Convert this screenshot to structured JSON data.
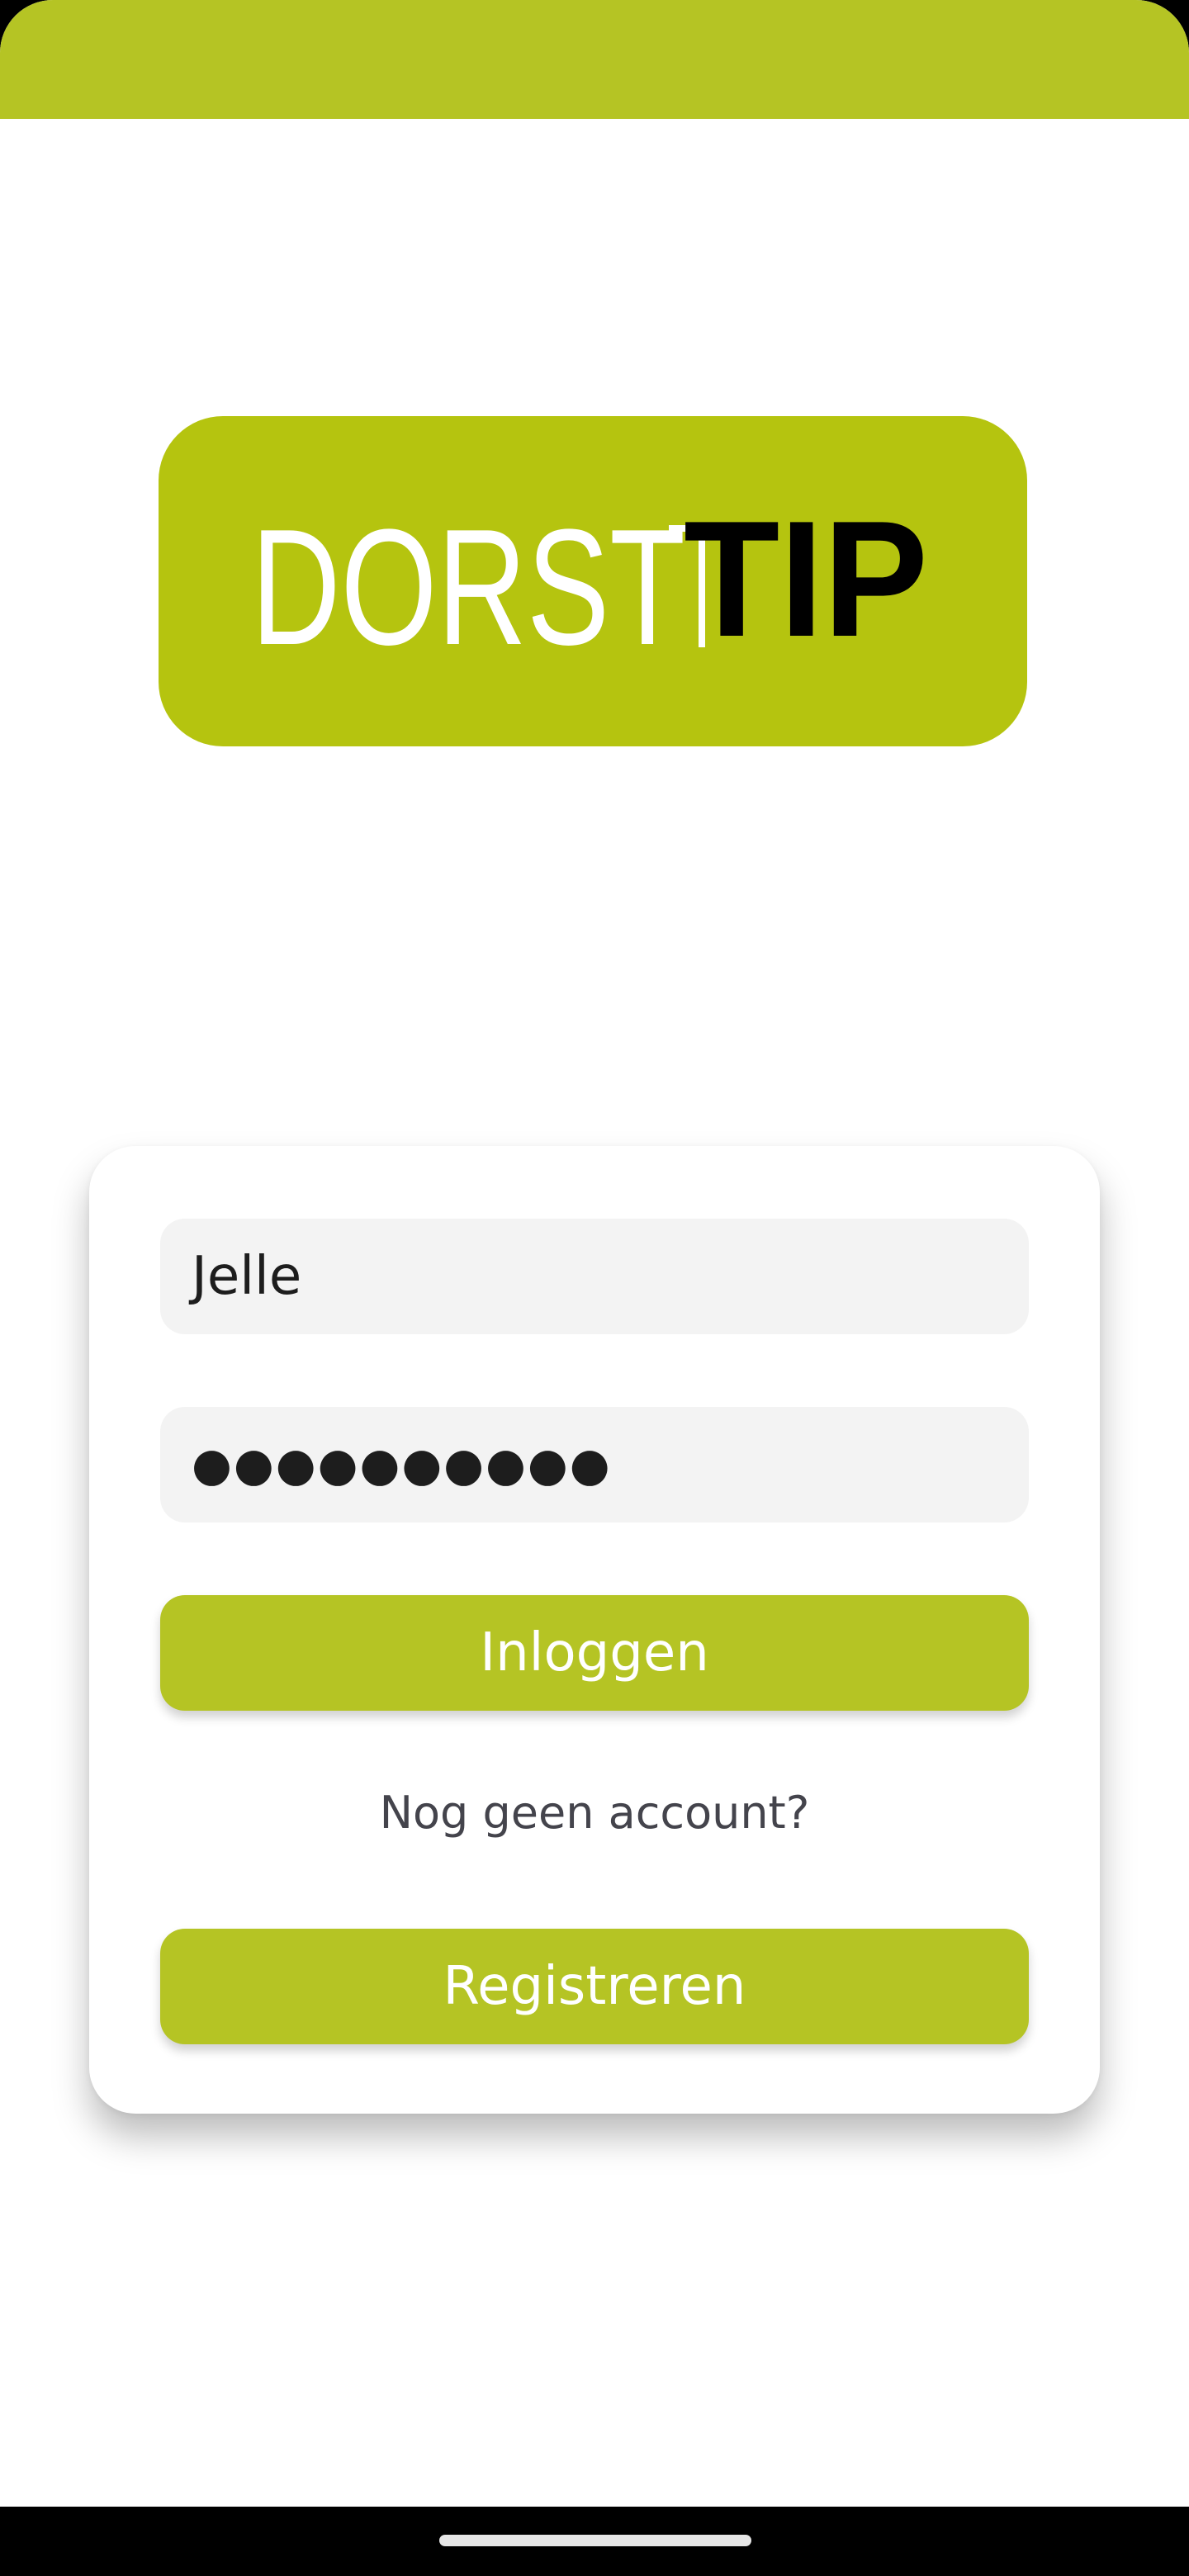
{
  "theme": {
    "accent": "#b5c424",
    "logo_background": "#b5c40f",
    "field_background": "#f3f3f3",
    "text_dark": "#1d1d1d",
    "text_muted": "#44444c"
  },
  "logo": {
    "part1": "DORST",
    "part2": "TIP"
  },
  "login": {
    "username_value": "Jelle",
    "password_mask": "●●●●●●●●●●",
    "login_button": "Inloggen",
    "no_account_text": "Nog geen account?",
    "register_button": "Registreren"
  },
  "system": {
    "home_indicator": "home-indicator"
  }
}
